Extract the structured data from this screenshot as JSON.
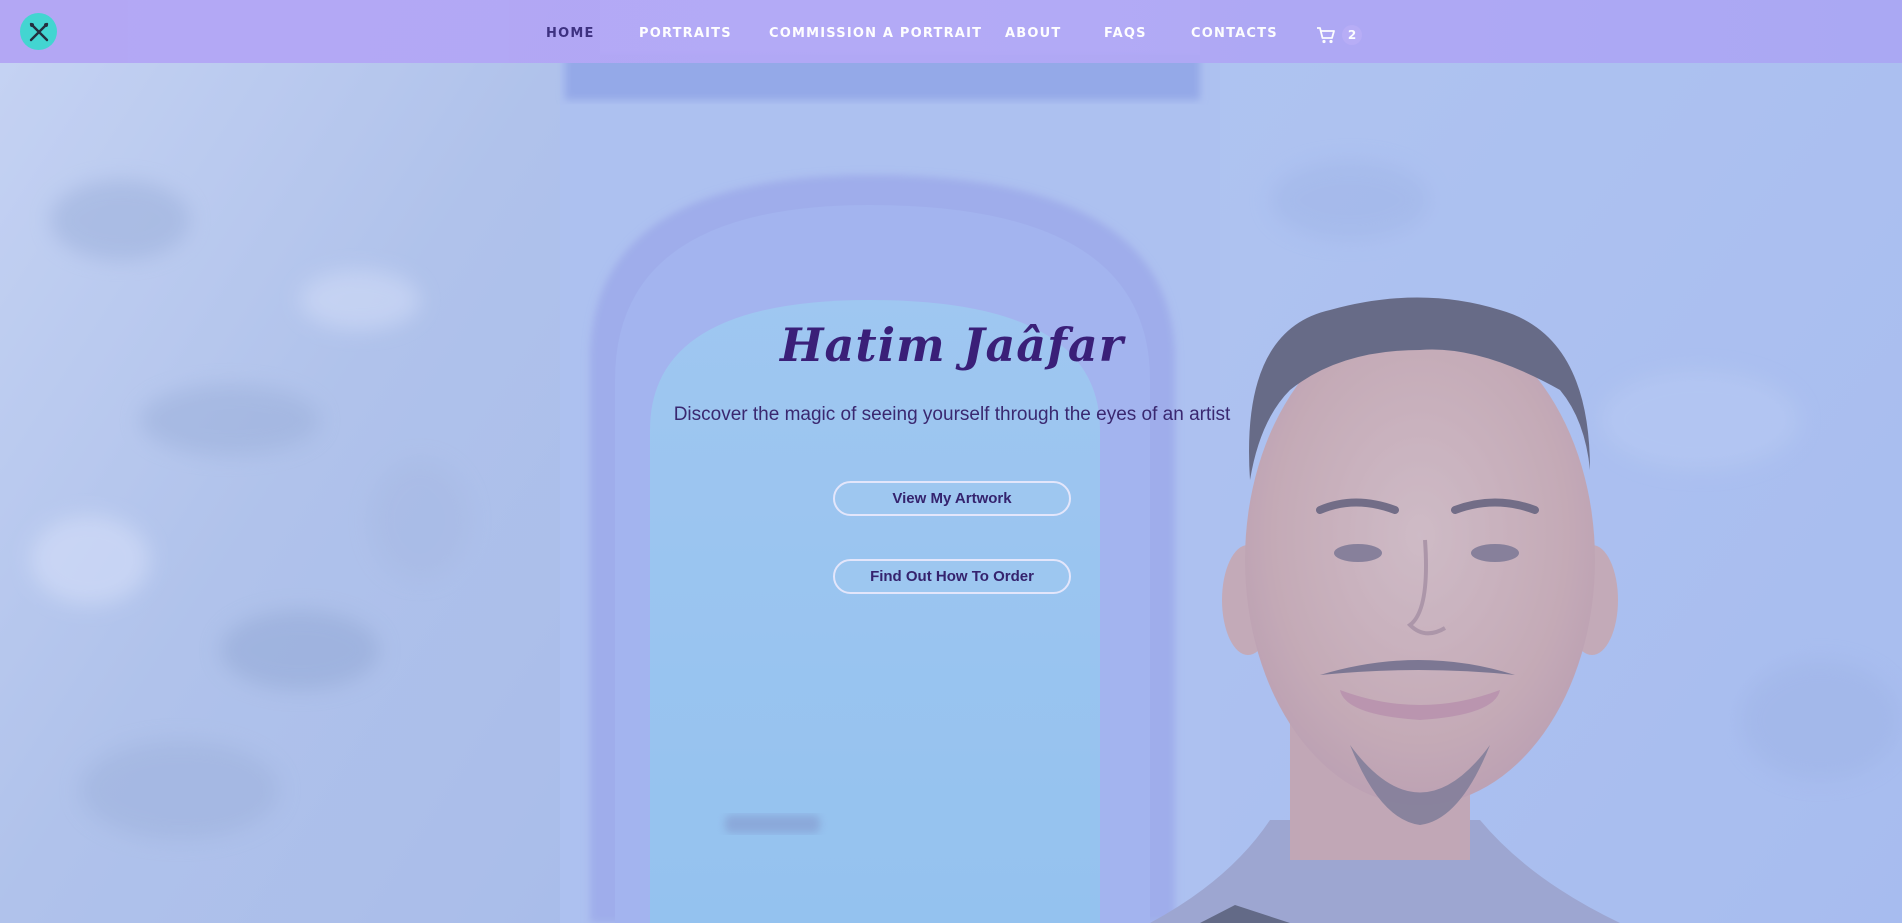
{
  "brand": {
    "logo_icon": "crossed-brushes-icon",
    "accent_color": "#3fd6d0"
  },
  "nav": {
    "items": [
      {
        "label": "HOME",
        "active": true
      },
      {
        "label": "PORTRAITS",
        "active": false
      },
      {
        "label": "COMMISSION A PORTRAIT",
        "active": false
      },
      {
        "label": "ABOUT",
        "active": false
      },
      {
        "label": "FAQS",
        "active": false
      },
      {
        "label": "CONTACTS",
        "active": false
      }
    ],
    "cart": {
      "icon": "shopping-cart-icon",
      "count": "2"
    },
    "background_color": "#b2a8f6"
  },
  "hero": {
    "title": "Hatim Jaâfar",
    "subtitle": "Discover the magic of seeing yourself through the eyes of an artist",
    "buttons": [
      {
        "label": "View My Artwork"
      },
      {
        "label": "Find Out How To Order"
      }
    ],
    "title_color": "#3a1f78"
  }
}
